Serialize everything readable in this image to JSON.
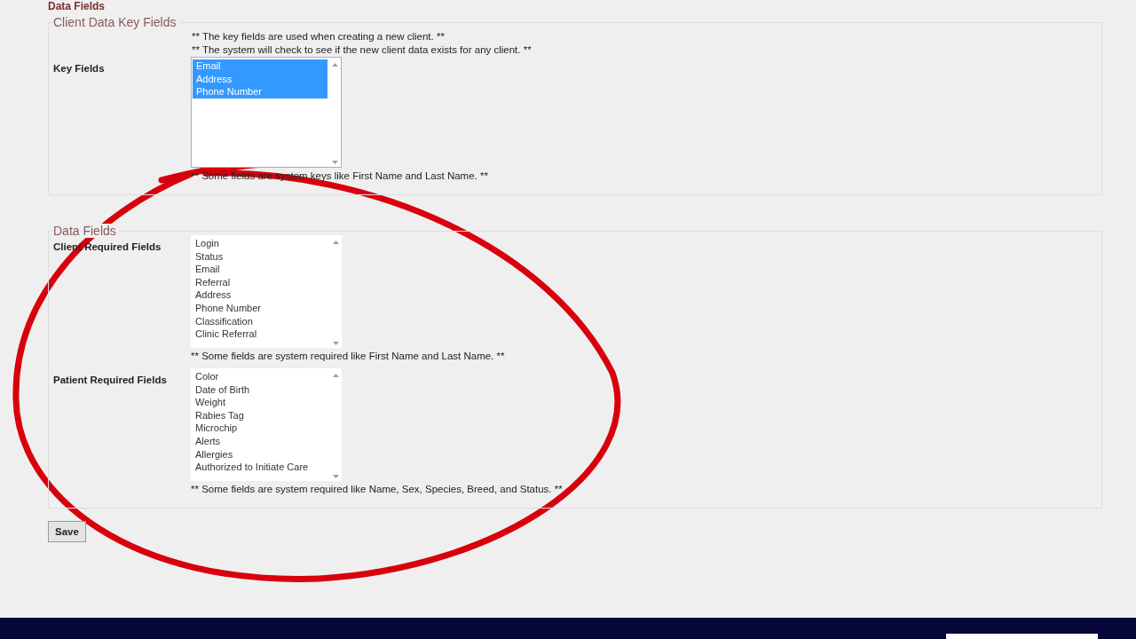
{
  "page_heading": "Data Fields",
  "key_section": {
    "legend": "Client Data Key Fields",
    "notes": [
      "** The key fields are used when creating a new client. **",
      "** The system will check to see if the new client data exists for any client. **"
    ],
    "fields": [
      {
        "label": "Key Fields",
        "options": [
          {
            "text": "Email",
            "selected": true
          },
          {
            "text": "Address",
            "selected": true
          },
          {
            "text": "Phone Number",
            "selected": true
          }
        ],
        "note": "** Some fields are system keys like First Name and Last Name. **"
      }
    ]
  },
  "data_section": {
    "legend": "Data Fields",
    "fields": [
      {
        "label": "Client Required Fields",
        "options": [
          {
            "text": "Login",
            "selected": false
          },
          {
            "text": "Status",
            "selected": false
          },
          {
            "text": "Email",
            "selected": false
          },
          {
            "text": "Referral",
            "selected": false
          },
          {
            "text": "Address",
            "selected": false
          },
          {
            "text": "Phone Number",
            "selected": false
          },
          {
            "text": "Classification",
            "selected": false
          },
          {
            "text": "Clinic Referral",
            "selected": false
          }
        ],
        "note": "** Some fields are system required like First Name and Last Name. **"
      },
      {
        "label": "Patient Required Fields",
        "options": [
          {
            "text": "Color",
            "selected": false
          },
          {
            "text": "Date of Birth",
            "selected": false
          },
          {
            "text": "Weight",
            "selected": false
          },
          {
            "text": "Rabies Tag",
            "selected": false
          },
          {
            "text": "Microchip",
            "selected": false
          },
          {
            "text": "Alerts",
            "selected": false
          },
          {
            "text": "Allergies",
            "selected": false
          },
          {
            "text": "Authorized to Initiate Care",
            "selected": false
          }
        ],
        "note": "** Some fields are system required like Name, Sex, Species, Breed, and Status. **"
      }
    ]
  },
  "save_button": "Save"
}
